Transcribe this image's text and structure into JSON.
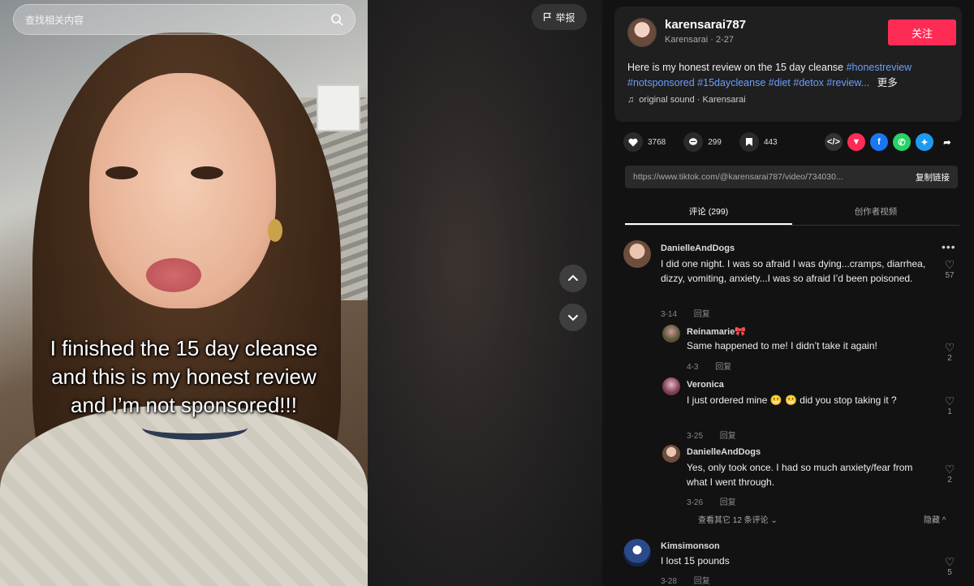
{
  "search": {
    "placeholder": "查找相关内容"
  },
  "video": {
    "caption_lines": [
      "I finished the 15 day cleanse",
      "and this is my honest review",
      "and I’m not sponsored!!!"
    ],
    "report_label": "举报"
  },
  "author": {
    "username": "karensarai787",
    "display": "Karensarai · 2-27",
    "follow_label": "关注",
    "description": "Here is my honest review on the 15 day cleanse",
    "hashtags": [
      "#honestreview",
      "#notsponsored",
      "#15daycleanse",
      "#diet",
      "#detox",
      "#review..."
    ],
    "more_label": "更多",
    "sound": "original sound · Karensarai"
  },
  "actions": {
    "likes": "3768",
    "comments": "299",
    "saves": "443",
    "share_icons": [
      "embed-icon",
      "pinterest-icon",
      "facebook-icon",
      "whatsapp-icon",
      "twitter-icon",
      "share-arrow-icon"
    ]
  },
  "link": {
    "url": "https://www.tiktok.com/@karensarai787/video/734030...",
    "copy_label": "复制链接"
  },
  "tabs": [
    {
      "label": "评论 (299)",
      "active": true
    },
    {
      "label": "创作者视频",
      "active": false
    }
  ],
  "comments": [
    {
      "user": "DanielleAndDogs",
      "text": "I did one night. I was so afraid I was dying...cramps, diarrhea, dizzy, vomiting, anxiety...I was so afraid I’d been poisoned.",
      "date": "3-14",
      "reply": "回复",
      "likes": "57"
    },
    {
      "user": "Reinamarie🎀",
      "text": "Same happened to me! I didn’t take it again!",
      "date": "4-3",
      "reply": "回复",
      "likes": "2"
    },
    {
      "user": "Veronica",
      "text": "I just ordered mine 😬 😬 did you stop taking it ?",
      "date": "3-25",
      "reply": "回复",
      "likes": "1"
    },
    {
      "user": "DanielleAndDogs",
      "text": "Yes, only took once. I had so much anxiety/fear from what I went through.",
      "date": "3-26",
      "reply": "回复",
      "likes": "2"
    },
    {
      "user": "Kimsimonson",
      "text": "I lost 15 pounds",
      "date": "3-28",
      "reply": "回复",
      "likes": "5"
    }
  ],
  "view_more": "查看其它 12 条评论",
  "collapse": "隐藏"
}
